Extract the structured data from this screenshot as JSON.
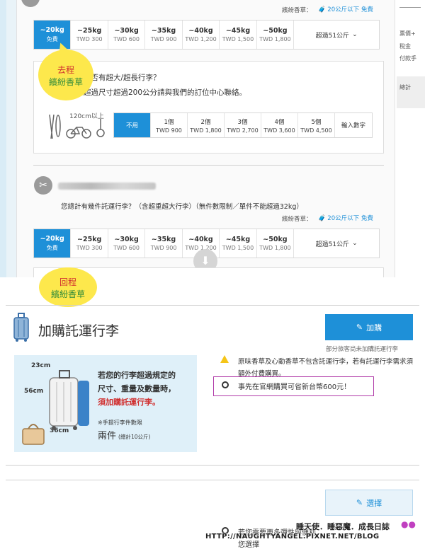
{
  "top_label": {
    "text": "繽紛香草：",
    "info": "20公斤以下 免費"
  },
  "weights_go": [
    {
      "w": "~20kg",
      "p": "免費"
    },
    {
      "w": "~25kg",
      "p": "TWD 300"
    },
    {
      "w": "~30kg",
      "p": "TWD 600"
    },
    {
      "w": "~35kg",
      "p": "TWD 900"
    },
    {
      "w": "~40kg",
      "p": "TWD 1,200"
    },
    {
      "w": "~45kg",
      "p": "TWD 1,500"
    },
    {
      "w": "~50kg",
      "p": "TWD 1,800"
    }
  ],
  "more_label": "超過51公斤",
  "callout_go": {
    "line1": "去程",
    "line2": "繽紛香草"
  },
  "oversize": {
    "q1": "是否有超大/超長行李？",
    "q2": "超過尺寸超過200公分請與我們的訂位中心聯絡。",
    "size_label": "120cm以上"
  },
  "quantities": [
    {
      "n": "不用",
      "p": ""
    },
    {
      "n": "1個",
      "p": "TWD 900"
    },
    {
      "n": "2個",
      "p": "TWD 1,800"
    },
    {
      "n": "3個",
      "p": "TWD 2,700"
    },
    {
      "n": "4個",
      "p": "TWD 3,600"
    },
    {
      "n": "5個",
      "p": "TWD 4,500"
    },
    {
      "n": "輸入數字",
      "p": ""
    }
  ],
  "passenger2": {
    "question": "您總計有幾件託運行李？（含超重超大行李）（無件數限制／單件不能超過32kg）",
    "label": "繽紛香草：",
    "info": "20公斤以下 免費"
  },
  "weights_return": [
    {
      "w": "~20kg",
      "p": "免費"
    },
    {
      "w": "~25kg",
      "p": "TWD 300"
    },
    {
      "w": "~30kg",
      "p": "TWD 600"
    },
    {
      "w": "~35kg",
      "p": "TWD 900"
    },
    {
      "w": "~40kg",
      "p": "TWD 1,200"
    },
    {
      "w": "~45kg",
      "p": "TWD 1,500"
    },
    {
      "w": "~50kg",
      "p": "TWD 1,800"
    }
  ],
  "callout_return": {
    "line1": "回程",
    "line2": "繽紛香草"
  },
  "sidebar": {
    "line1": "票價+",
    "line2": "稅金",
    "line3": "付款手",
    "total": "總計"
  },
  "addon": {
    "title": "加購託運行李",
    "button": "加購",
    "note": "部分旅客尚未加購託運行李",
    "warning": "原味香草及心動香草不包含託運行李，若有託運行李需求須額外付費購買。",
    "save": "事先在官網購買可省新台幣600元！",
    "promo_line1": "若您的行李超過規定的",
    "promo_line2": "尺寸、重量及數量時，",
    "promo_line3": "須加購託運行李。",
    "promo_small": "※手提行李件數限",
    "promo_count": "兩件",
    "promo_count_note": "(總計10公斤)",
    "dim_h": "23cm",
    "dim_v": "56cm",
    "dim_d": "36cm"
  },
  "select_button": "選擇",
  "bottom_text": "若您需要更多彈性與便利",
  "bottom_text2": "您選擇",
  "watermark_line1": "睡天使．睡惡魔．成長日誌",
  "watermark_line2": "HTTP://NAUGHTYANGEL.PIXNET.NET/BLOG",
  "colors": {
    "accent": "#1e90d8",
    "callout": "#fde84c",
    "go_text": "#d03030",
    "green_text": "#2e8a3a",
    "highlight_border": "#b03aa8"
  }
}
